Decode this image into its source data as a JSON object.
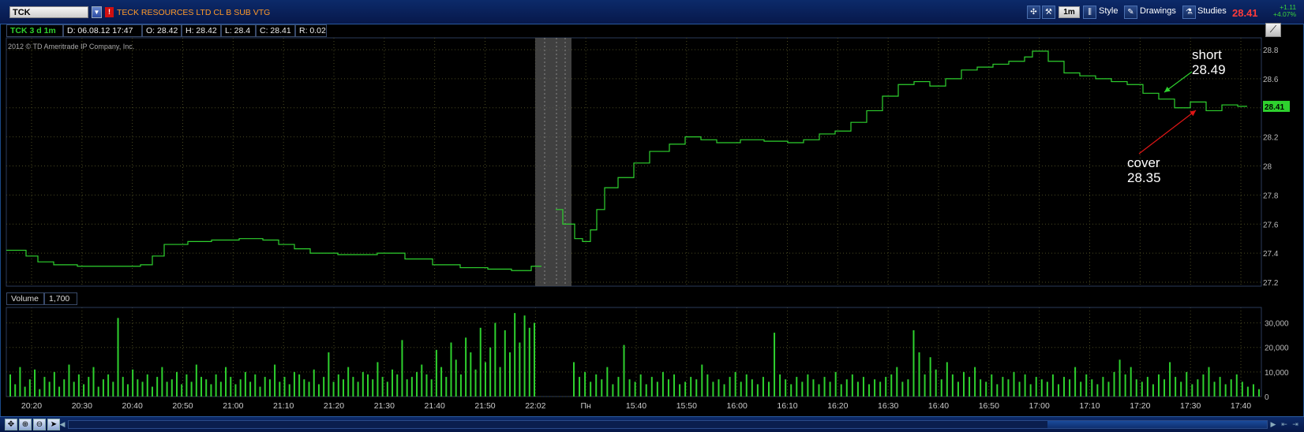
{
  "toolbar": {
    "symbol": "TCK",
    "flag": "!",
    "description": "TECK RESOURCES LTD CL B SUB VTG",
    "aggregation": "1m",
    "style_label": "Style",
    "drawings_label": "Drawings",
    "studies_label": "Studies",
    "last_price": "28.41",
    "net_change": "+1.11",
    "pct_change": "+4.07%"
  },
  "info": {
    "title": "TCK 3 d 1m",
    "date": "D: 06.08.12 17:47",
    "open": "O: 28.42",
    "high": "H: 28.42",
    "low": "L: 28.4",
    "close": "C: 28.41",
    "range": "R: 0.02",
    "copyright": "2012 © TD Ameritrade IP Company, Inc."
  },
  "volume": {
    "label": "Volume",
    "value": "1,700"
  },
  "annotations": {
    "short_label": "short",
    "short_price": "28.49",
    "cover_label": "cover",
    "cover_price": "28.35"
  },
  "colors": {
    "price_line": "#2ed12e",
    "grid": "#4a4a22",
    "session_break": "#555555",
    "short_arrow": "#2ed12e",
    "cover_arrow": "#e01616"
  },
  "chart_data": [
    {
      "type": "line",
      "title": "TCK 3 d 1m",
      "price_axis_ticks": [
        "28.8",
        "28.6",
        "28.4",
        "28.2",
        "28",
        "27.8",
        "27.6",
        "27.4",
        "27.2"
      ],
      "ylim": [
        27.2,
        28.8
      ],
      "time_labels": [
        "20:20",
        "20:30",
        "20:40",
        "20:50",
        "21:00",
        "21:10",
        "21:20",
        "21:30",
        "21:40",
        "21:50",
        "22:02",
        "Пн",
        "15:40",
        "15:50",
        "16:00",
        "16:10",
        "16:20",
        "16:30",
        "16:40",
        "16:50",
        "17:00",
        "17:10",
        "17:20",
        "17:30",
        "17:40"
      ],
      "series": [
        {
          "name": "TCK",
          "points": [
            [
              0,
              27.42
            ],
            [
              10,
              27.42
            ],
            [
              25,
              27.38
            ],
            [
              40,
              27.34
            ],
            [
              60,
              27.32
            ],
            [
              90,
              27.31
            ],
            [
              130,
              27.31
            ],
            [
              170,
              27.32
            ],
            [
              185,
              27.38
            ],
            [
              200,
              27.46
            ],
            [
              230,
              27.48
            ],
            [
              260,
              27.49
            ],
            [
              295,
              27.5
            ],
            [
              325,
              27.49
            ],
            [
              345,
              27.46
            ],
            [
              365,
              27.43
            ],
            [
              385,
              27.4
            ],
            [
              420,
              27.39
            ],
            [
              470,
              27.4
            ],
            [
              505,
              27.36
            ],
            [
              540,
              27.32
            ],
            [
              575,
              27.3
            ],
            [
              610,
              27.29
            ],
            [
              640,
              27.28
            ],
            [
              665,
              27.31
            ],
            [
              678,
              27.31
            ],
            [
              696,
              27.7
            ],
            [
              705,
              27.6
            ],
            [
              720,
              27.5
            ],
            [
              730,
              27.48
            ],
            [
              740,
              27.56
            ],
            [
              748,
              27.7
            ],
            [
              758,
              27.85
            ],
            [
              775,
              27.92
            ],
            [
              795,
              28.02
            ],
            [
              815,
              28.1
            ],
            [
              840,
              28.15
            ],
            [
              860,
              28.2
            ],
            [
              880,
              28.18
            ],
            [
              900,
              28.16
            ],
            [
              930,
              28.18
            ],
            [
              960,
              28.17
            ],
            [
              990,
              28.16
            ],
            [
              1010,
              28.18
            ],
            [
              1030,
              28.22
            ],
            [
              1050,
              28.24
            ],
            [
              1070,
              28.3
            ],
            [
              1090,
              28.38
            ],
            [
              1110,
              28.48
            ],
            [
              1130,
              28.56
            ],
            [
              1150,
              28.58
            ],
            [
              1170,
              28.55
            ],
            [
              1190,
              28.6
            ],
            [
              1210,
              28.66
            ],
            [
              1230,
              28.68
            ],
            [
              1250,
              28.7
            ],
            [
              1270,
              28.72
            ],
            [
              1290,
              28.75
            ],
            [
              1300,
              28.79
            ],
            [
              1320,
              28.72
            ],
            [
              1340,
              28.64
            ],
            [
              1360,
              28.62
            ],
            [
              1380,
              28.6
            ],
            [
              1400,
              28.58
            ],
            [
              1420,
              28.56
            ],
            [
              1440,
              28.5
            ],
            [
              1460,
              28.46
            ],
            [
              1480,
              28.4
            ],
            [
              1500,
              28.44
            ],
            [
              1520,
              28.38
            ],
            [
              1540,
              28.42
            ],
            [
              1560,
              28.41
            ],
            [
              1572,
              28.41
            ]
          ]
        }
      ]
    },
    {
      "type": "bar",
      "title": "Volume",
      "ylabel": "",
      "ticks": [
        "30,000",
        "20,000",
        "10,000",
        "0"
      ],
      "ylim": [
        0,
        35000
      ],
      "values": [
        9000,
        5000,
        12000,
        4000,
        7000,
        11000,
        3000,
        8000,
        6000,
        10000,
        4000,
        7000,
        13000,
        6000,
        9000,
        5000,
        8000,
        12000,
        4000,
        7000,
        9000,
        6000,
        32000,
        8000,
        5000,
        11000,
        7000,
        6000,
        9000,
        4000,
        8000,
        12000,
        6000,
        7000,
        10000,
        5000,
        9000,
        6000,
        13000,
        8000,
        7000,
        5000,
        9000,
        6000,
        12000,
        8000,
        5000,
        7000,
        10000,
        6000,
        9000,
        4000,
        8000,
        7000,
        13000,
        6000,
        8000,
        5000,
        10000,
        9000,
        7000,
        6000,
        11000,
        5000,
        8000,
        18000,
        6000,
        9000,
        7000,
        12000,
        8000,
        6000,
        10000,
        9000,
        7000,
        14000,
        8000,
        6000,
        11000,
        9000,
        23000,
        7000,
        8000,
        10000,
        13000,
        9000,
        7000,
        19000,
        12000,
        8000,
        22000,
        15000,
        9000,
        24000,
        18000,
        11000,
        28000,
        14000,
        20000,
        30000,
        12000,
        27000,
        18000,
        34000,
        22000,
        33000,
        28000,
        30000,
        14000,
        8000,
        10000,
        6000,
        9000,
        7000,
        12000,
        5000,
        8000,
        21000,
        7000,
        6000,
        9000,
        5000,
        8000,
        6000,
        10000,
        7000,
        9000,
        5000,
        6000,
        8000,
        7000,
        13000,
        9000,
        6000,
        7000,
        5000,
        8000,
        10000,
        6000,
        9000,
        7000,
        5000,
        8000,
        6000,
        26000,
        9000,
        7000,
        5000,
        8000,
        6000,
        9000,
        7000,
        5000,
        8000,
        6000,
        10000,
        5000,
        7000,
        9000,
        6000,
        8000,
        5000,
        7000,
        6000,
        8000,
        9000,
        12000,
        6000,
        7000,
        27000,
        18000,
        9000,
        16000,
        11000,
        7000,
        14000,
        9000,
        6000,
        10000,
        8000,
        12000,
        7000,
        6000,
        9000,
        5000,
        8000,
        7000,
        10000,
        6000,
        9000,
        5000,
        8000,
        7000,
        6000,
        9000,
        5000,
        8000,
        7000,
        12000,
        6000,
        9000,
        7000,
        5000,
        8000,
        6000,
        10000,
        15000,
        9000,
        12000,
        7000,
        6000,
        8000,
        5000,
        9000,
        7000,
        14000,
        8000,
        6000,
        10000,
        5000,
        7000,
        9000,
        12000,
        6000,
        8000,
        5000,
        7000,
        9000,
        6000,
        4000,
        5000,
        3000
      ]
    }
  ]
}
